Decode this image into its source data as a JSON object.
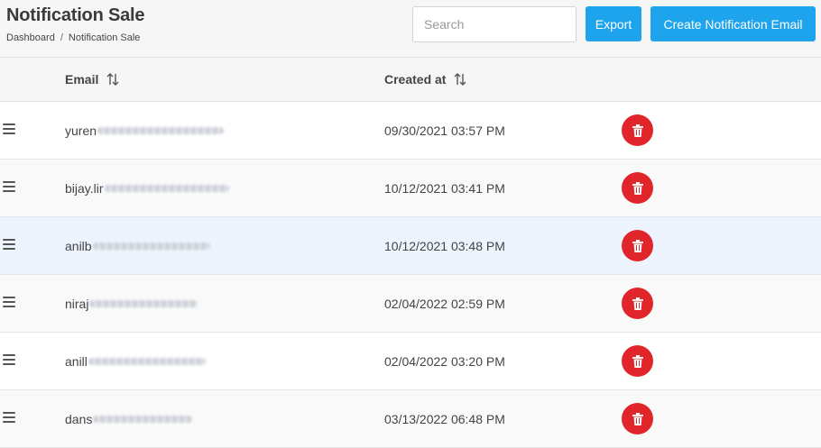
{
  "header": {
    "title": "Notification Sale",
    "breadcrumb": [
      "Dashboard",
      "Notification Sale"
    ],
    "search_placeholder": "Search",
    "export_label": "Export",
    "create_label": "Create Notification Email"
  },
  "table": {
    "columns": {
      "email": "Email",
      "created_at": "Created at"
    },
    "rows": [
      {
        "email_visible": "yuren",
        "created_at": "09/30/2021 03:57 PM"
      },
      {
        "email_visible": "bijay.lir",
        "created_at": "10/12/2021 03:41 PM"
      },
      {
        "email_visible": "anilb",
        "created_at": "10/12/2021 03:48 PM"
      },
      {
        "email_visible": "niraj",
        "created_at": "02/04/2022 02:59 PM"
      },
      {
        "email_visible": "anill",
        "created_at": "02/04/2022 03:20 PM"
      },
      {
        "email_visible": "dans",
        "created_at": "03/13/2022 06:48 PM"
      }
    ]
  },
  "icons": {
    "sort": "sort-arrows-icon",
    "drag": "drag-handle-icon",
    "delete": "trash-icon"
  },
  "colors": {
    "primary_button": "#1ea4ec",
    "delete_button": "#e0262b",
    "highlighted_row": "#edf4fd"
  }
}
